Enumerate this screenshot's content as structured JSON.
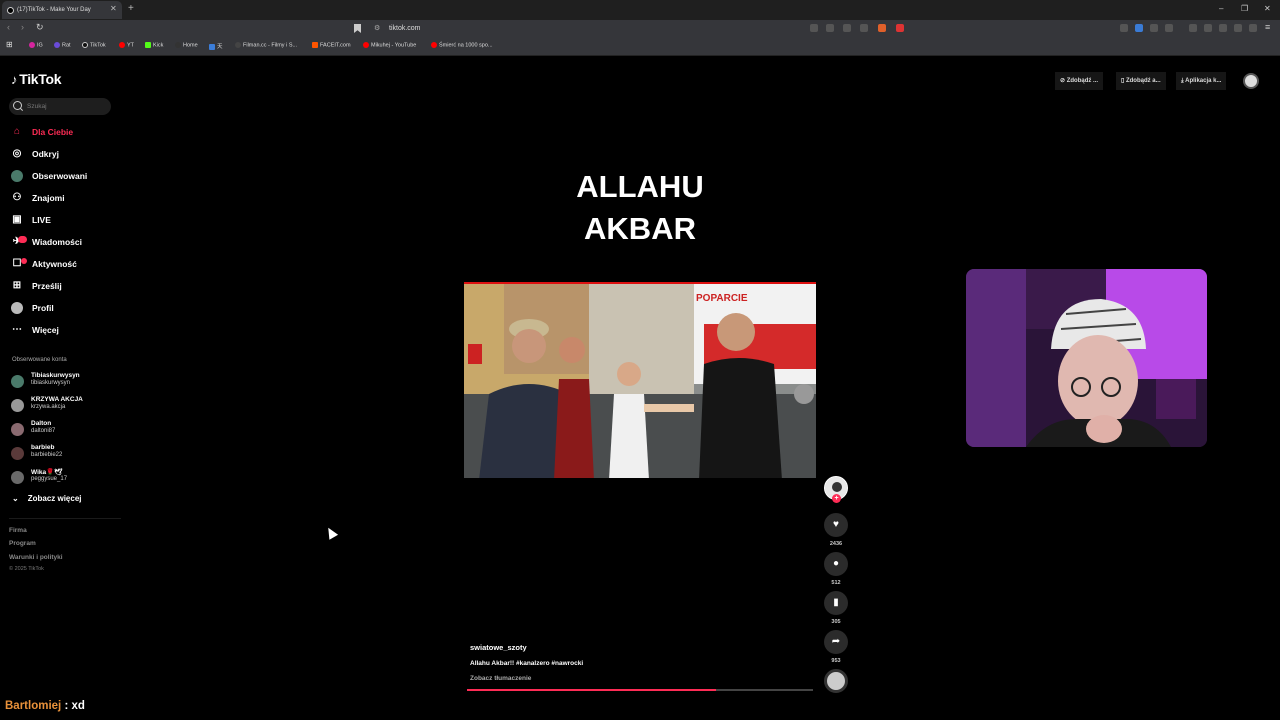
{
  "browser": {
    "tab_title": "(17)TikTok - Make Your Day",
    "url": "tiktok.com",
    "bookmarks": [
      "IG",
      "Rat",
      "TikTok",
      "YT",
      "Kick",
      "Home",
      "天",
      "Filman.cc - Filmy i S...",
      "FACEIT.com",
      "Mikuhej - YouTube",
      "Śmierć na 1000 spo..."
    ]
  },
  "sidebar": {
    "logo": "TikTok",
    "search_placeholder": "Szukaj",
    "nav": [
      {
        "label": "Dla Ciebie",
        "icon": "home-icon"
      },
      {
        "label": "Odkryj",
        "icon": "compass-icon"
      },
      {
        "label": "Obserwowani",
        "icon": "following-avatar-icon"
      },
      {
        "label": "Znajomi",
        "icon": "friends-icon"
      },
      {
        "label": "LIVE",
        "icon": "live-icon"
      },
      {
        "label": "Wiadomości",
        "icon": "messages-icon"
      },
      {
        "label": "Aktywność",
        "icon": "activity-icon"
      },
      {
        "label": "Prześlij",
        "icon": "upload-icon"
      },
      {
        "label": "Profil",
        "icon": "profile-icon"
      },
      {
        "label": "Więcej",
        "icon": "more-icon"
      }
    ],
    "following_title": "Obserwowane konta",
    "accounts": [
      {
        "name": "Tibiaskurwysyn",
        "handle": "tibiaskurwysyn"
      },
      {
        "name": "KRZYWA AKCJA",
        "handle": "krzywa.akcja"
      },
      {
        "name": "Dalton",
        "handle": "daltoni87"
      },
      {
        "name": "barbieb",
        "handle": "barbiebie22"
      },
      {
        "name": "Wika🌹🕊",
        "handle": "peggysue_17"
      }
    ],
    "see_more": "Zobacz więcej",
    "footer": [
      "Firma",
      "Program",
      "Warunki i polityki"
    ],
    "copyright": "© 2025 TikTok"
  },
  "topbar": {
    "buttons": [
      "Zdobądź ...",
      "Zdobądź a...",
      "Aplikacja k..."
    ]
  },
  "video": {
    "overlay_title": "ALLAHU AKBAR",
    "author": "swiatowe_szoty",
    "description": "Allahu Akbar!! #kanalzero #nawrocki",
    "translate": "Zobacz tłumaczenie",
    "progress": 0.72,
    "likes": "2436",
    "comments": "512",
    "saves": "305",
    "shares": "953",
    "banner_text": "POPARCIE"
  },
  "chat": {
    "user": "Bartlomiej",
    "separator": ":",
    "message": "xd"
  },
  "colors": {
    "accent": "#fe2c55",
    "chat_user": "#e8913a"
  }
}
